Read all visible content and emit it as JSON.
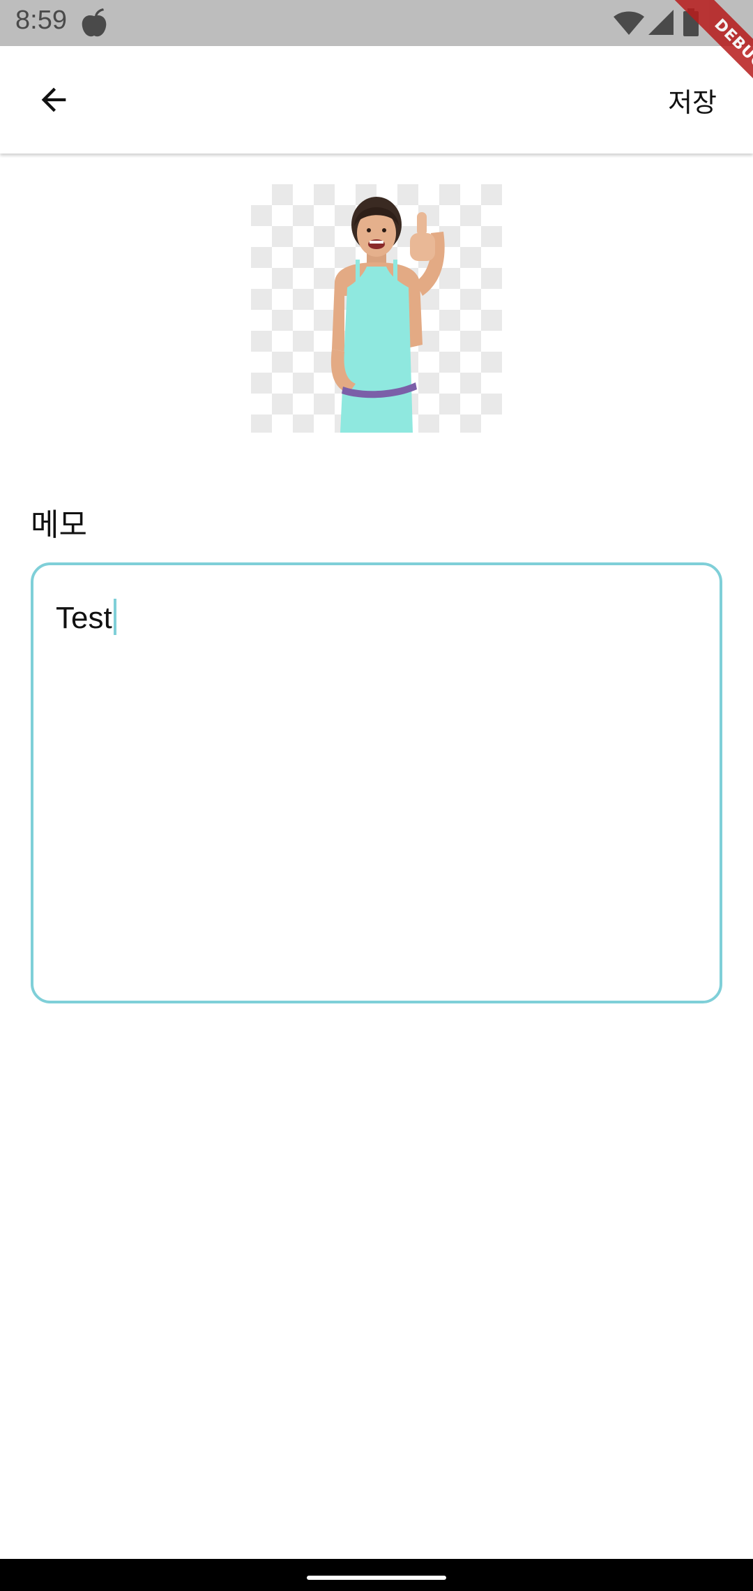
{
  "status_bar": {
    "time": "8:59",
    "background": "#bdbdbd",
    "icons": [
      "app-notification-icon",
      "wifi-icon",
      "signal-icon",
      "battery-icon"
    ]
  },
  "debug_banner": {
    "label": "DEBUG",
    "color": "#b71c1c"
  },
  "app_bar": {
    "back_icon": "arrow-left-icon",
    "save_label": "저장"
  },
  "image": {
    "description_icon": "profile-photo"
  },
  "memo": {
    "label": "메모",
    "value": "Test",
    "border_color": "#7fcfd8"
  },
  "nav_bar": {
    "handle": "gesture-handle"
  }
}
